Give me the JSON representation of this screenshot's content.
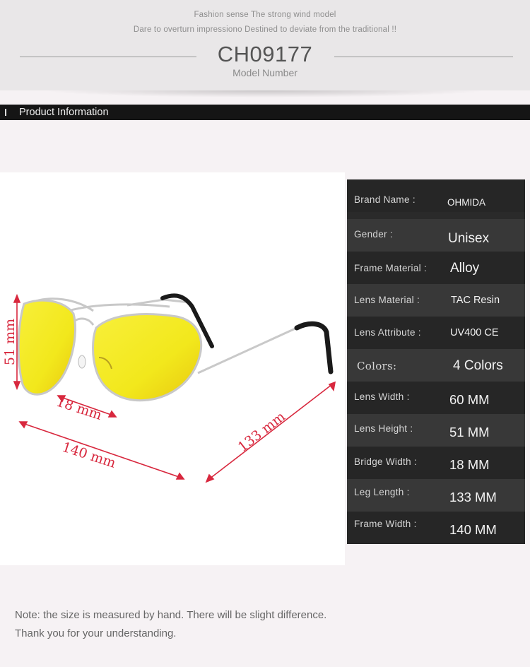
{
  "header": {
    "tagline_1": "Fashion sense The strong wind model",
    "tagline_2": "Dare to overturn impressiono Destined to deviate from the traditional !!",
    "model_code": "CH09177",
    "model_label": "Model Number"
  },
  "section": {
    "title": "Product Information"
  },
  "dimensions": {
    "height": "51 mm",
    "bridge": "18 mm",
    "frame": "140 mm",
    "leg": "133 mm"
  },
  "specs": [
    {
      "label": "Brand Name :",
      "value": "OHMIDA"
    },
    {
      "label": "Gender :",
      "value": "Unisex"
    },
    {
      "label": "Frame Material :",
      "value": "Alloy"
    },
    {
      "label": "Lens Material :",
      "value": "TAC Resin"
    },
    {
      "label": "Lens Attribute :",
      "value": "UV400 CE"
    },
    {
      "label": "Colors:",
      "value": "4 Colors"
    },
    {
      "label": "Lens Width :",
      "value": "60 MM"
    },
    {
      "label": "Lens Height :",
      "value": "51 MM"
    },
    {
      "label": "Bridge Width :",
      "value": "18 MM"
    },
    {
      "label": "Leg Length :",
      "value": "133 MM"
    },
    {
      "label": "Frame Width :",
      "value": "140 MM"
    }
  ],
  "note": {
    "line_1": "Note: the size is measured by hand. There will be slight difference.",
    "line_2": "Thank you for your understanding."
  },
  "colors": {
    "lens": "#f2e81c",
    "dimension_line": "#d8283e",
    "frame": "#c8c8c8"
  }
}
